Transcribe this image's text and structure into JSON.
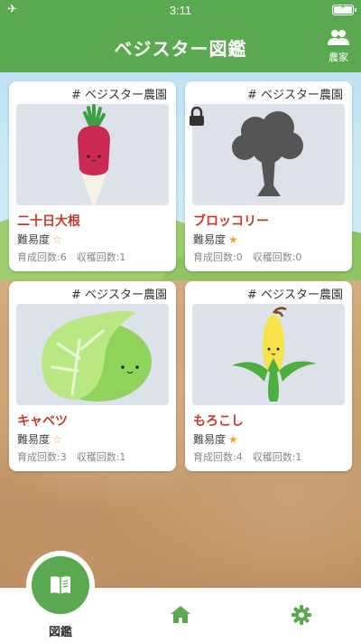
{
  "status_bar": {
    "time": "3:11"
  },
  "header": {
    "title": "ベジスター図鑑",
    "farmer_label": "農家"
  },
  "colors": {
    "brand_green": "#5aa84f",
    "name_red": "#c23a2c",
    "star_gold": "#f0a030"
  },
  "cards": [
    {
      "tag": "# ベジスター農園",
      "name": "二十日大根",
      "difficulty_label": "難易度",
      "difficulty_stars": "half",
      "counts": "育成回数:6　収穫回数:1",
      "locked": false,
      "icon": "radish"
    },
    {
      "tag": "# ベジスター農園",
      "name": "ブロッコリー",
      "difficulty_label": "難易度",
      "difficulty_stars": "full",
      "counts": "育成回数:0　収穫回数:0",
      "locked": true,
      "icon": "broccoli-silhouette"
    },
    {
      "tag": "# ベジスター農園",
      "name": "キャベツ",
      "difficulty_label": "難易度",
      "difficulty_stars": "half",
      "counts": "育成回数:3　収穫回数:1",
      "locked": false,
      "icon": "cabbage"
    },
    {
      "tag": "# ベジスター農園",
      "name": "もろこし",
      "difficulty_label": "難易度",
      "difficulty_stars": "full",
      "counts": "育成回数:4　収穫回数:1",
      "locked": false,
      "icon": "corn"
    }
  ],
  "bottom_nav": {
    "encyclopedia_label": "図鑑"
  }
}
